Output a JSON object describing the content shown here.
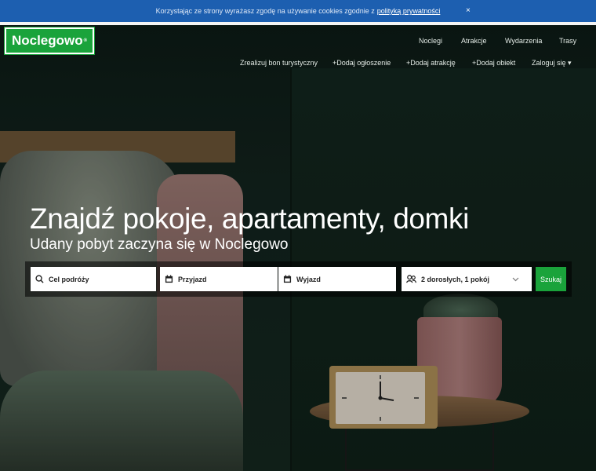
{
  "cookie": {
    "text": "Korzystając ze strony wyrażasz zgodę na używanie cookies zgodnie z",
    "link": "polityką prywatności",
    "close": "×"
  },
  "header": {
    "logo": "Noclegowo",
    "logo_mark": "®",
    "nav": [
      "Noclegi",
      "Atrakcje",
      "Wydarzenia",
      "Trasy"
    ],
    "subnav": [
      "Zrealizuj bon turystyczny",
      "+Dodaj ogłoszenie",
      "+Dodaj atrakcję",
      "+Dodaj obiekt",
      "Zaloguj się"
    ],
    "login_caret": "▾"
  },
  "hero": {
    "title": "Znajdź pokoje, apartamenty, domki",
    "subtitle": "Udany pobyt zaczyna się w Noclegowo"
  },
  "search": {
    "destination": "Cel podróży",
    "checkin": "Przyjazd",
    "checkout": "Wyjazd",
    "guests": "2 dorosłych, 1 pokój",
    "button": "Szukaj"
  },
  "colors": {
    "accent": "#1aa33b",
    "cookie_bar": "#1d5fb0"
  }
}
